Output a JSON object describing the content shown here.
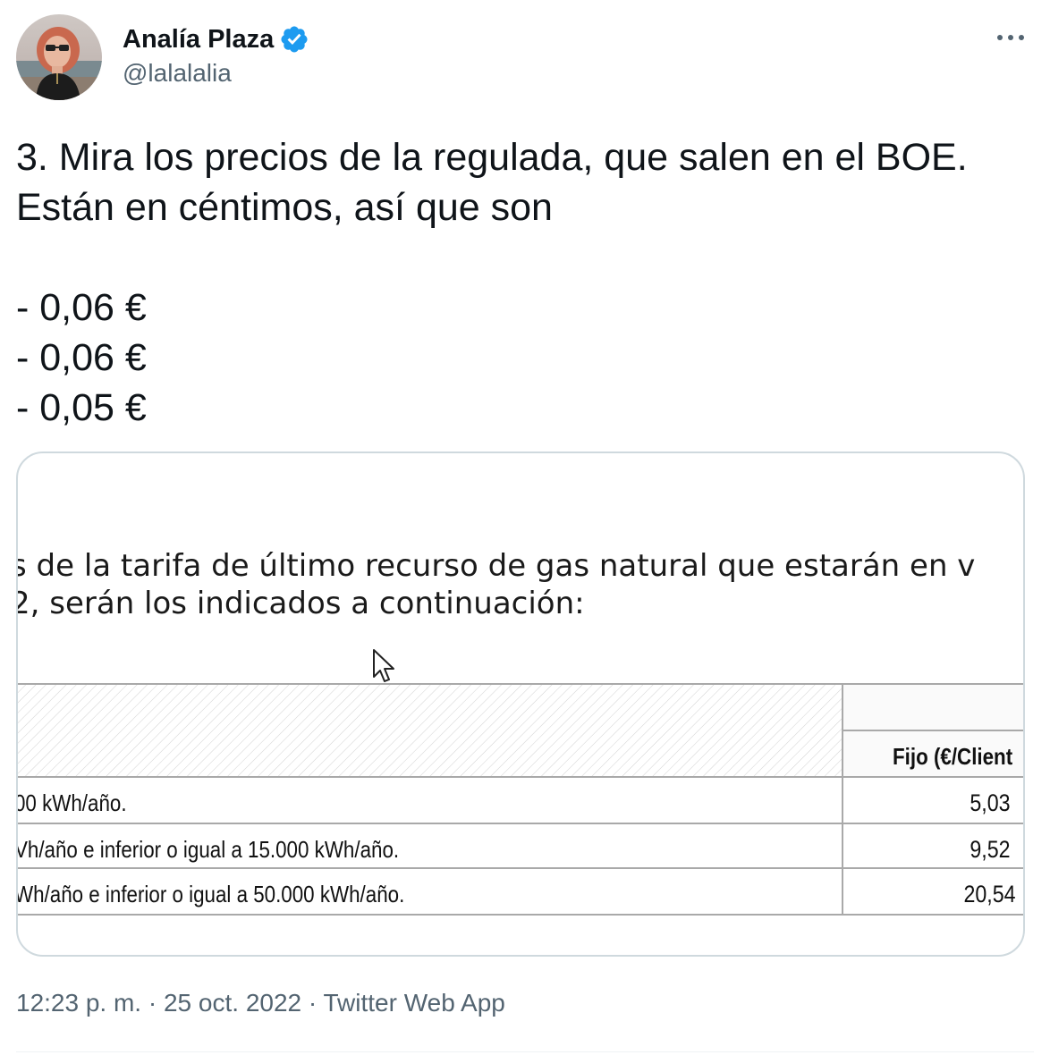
{
  "author": {
    "name": "Analía Plaza",
    "handle": "@lalalalia",
    "verified": true
  },
  "tweet": {
    "text": "3. Mira los precios de la regulada, que salen en el BOE.\nEstán en céntimos, así que son\n\n- 0,06 €\n- 0,06 €\n- 0,05 €"
  },
  "media": {
    "line1": "s de la tarifa de último recurso de gas natural que estarán en v",
    "line2": "2, serán los indicados a continuación:",
    "table": {
      "header": "Fijo (€/Client",
      "rows": [
        {
          "label": "00 kWh/año.",
          "value": "5,03"
        },
        {
          "label": "Vh/año e inferior o igual a 15.000 kWh/año.",
          "value": "9,52"
        },
        {
          "label": "Wh/año e inferior o igual a 50.000 kWh/año.",
          "value": "20,54"
        }
      ]
    }
  },
  "footer": {
    "time": "12:23 p. m.",
    "date": "25 oct. 2022",
    "source": "Twitter Web App",
    "separator": "·"
  },
  "colors": {
    "verified_badge": "#1d9bf0",
    "secondary_text": "#536471",
    "primary_text": "#0f1419",
    "border": "#cfd9de"
  },
  "icons": {
    "verified": "verified-badge-icon",
    "more": "more-options-icon",
    "cursor": "mouse-cursor-icon"
  }
}
